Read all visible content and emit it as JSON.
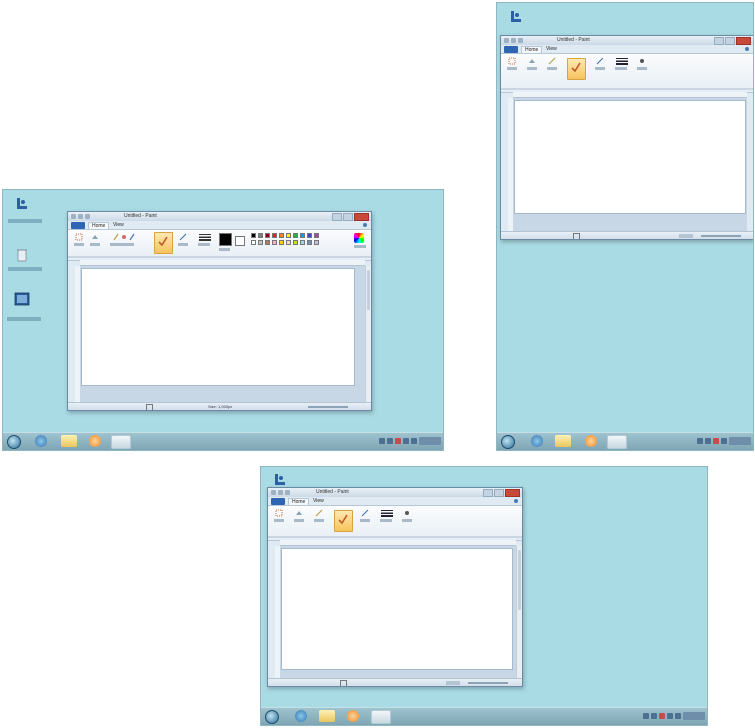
{
  "screens": [
    {
      "id": "screen-1",
      "paint": {
        "title": "Untitled - Paint",
        "tabs": [
          "Home",
          "View"
        ],
        "tools": [
          "Select",
          "Image",
          "Tools",
          "Brushes",
          "Shapes",
          "Size",
          "Color 1",
          "Color 2",
          "Edit colors"
        ],
        "status": "Size: 1,000px"
      },
      "desktop_icons": [
        "Computer",
        "Recycle Bin",
        "Display Settings"
      ],
      "swatch_colors": [
        "#000000",
        "#7f7f7f",
        "#880015",
        "#ed1c24",
        "#ff7f27",
        "#fff200",
        "#22b14c",
        "#00a2e8",
        "#3f48cc",
        "#a349a4",
        "#ffffff",
        "#c3c3c3",
        "#b97a57",
        "#ffaec9",
        "#ffc90e",
        "#efe4b0",
        "#b5e61d",
        "#99d9ea",
        "#7092be",
        "#c8bfe7"
      ]
    },
    {
      "id": "screen-2",
      "paint": {
        "title": "Untitled - Paint",
        "tabs": [
          "Home",
          "View"
        ],
        "tools": [
          "Select",
          "Image",
          "Tools",
          "Brushes",
          "Shapes",
          "Size",
          "Colors"
        ]
      }
    },
    {
      "id": "screen-3",
      "paint": {
        "title": "Untitled - Paint",
        "tabs": [
          "Home",
          "View"
        ],
        "tools": [
          "Select",
          "Image",
          "Tools",
          "Brushes",
          "Shapes",
          "Size",
          "Colors"
        ]
      }
    }
  ],
  "taskbar": {
    "items": [
      "start-icon",
      "ie-icon",
      "folder-icon",
      "media-player-icon",
      "paint-icon"
    ]
  },
  "colors": {
    "desktop": "#a9dbe5",
    "taskbar": "#8fb3c0",
    "ribbon_active": "#f6c35d",
    "file_tab": "#2e66b3",
    "close_button": "#c8483a"
  }
}
